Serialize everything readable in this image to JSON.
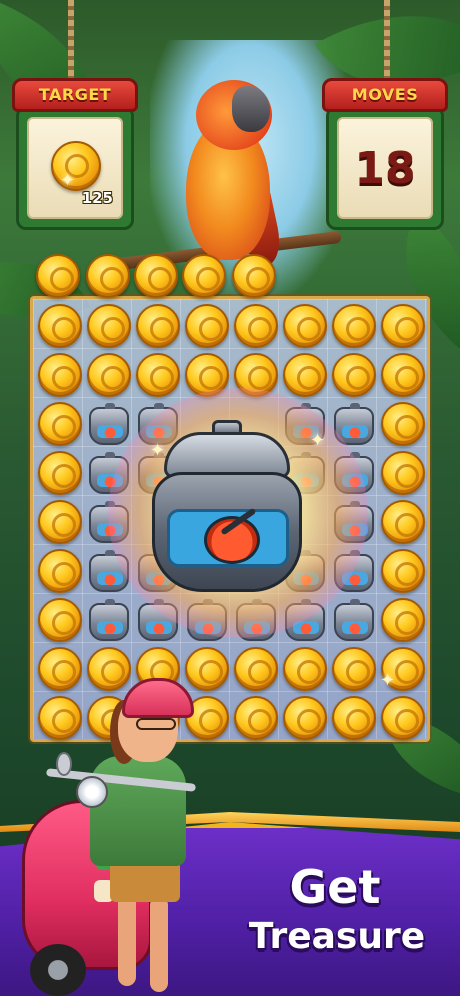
{
  "hud": {
    "target": {
      "label": "TARGET",
      "icon": "coin-icon",
      "count": "125"
    },
    "moves": {
      "label": "MOVES",
      "value": "18"
    }
  },
  "board": {
    "rows": 9,
    "cols": 8,
    "tiles": [
      "coin-icon",
      "pressure-cooker-icon"
    ],
    "featured_item": "pressure-cooker-icon"
  },
  "cta": {
    "line1": "Get",
    "line2": "Treasure"
  },
  "colors": {
    "panel_header": "#c8281f",
    "panel_frame": "#2f7a32",
    "coin": "#ffc81e",
    "banner": "#5a24b5",
    "banner_border": "#f2b41e"
  }
}
